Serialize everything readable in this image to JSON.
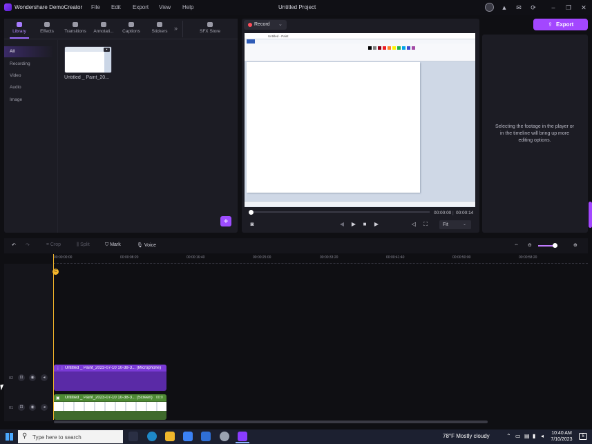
{
  "app": {
    "name": "Wondershare DemoCreator",
    "project_title": "Untitled Project"
  },
  "menu": {
    "file": "File",
    "edit": "Edit",
    "export": "Export",
    "view": "View",
    "help": "Help"
  },
  "tabs": [
    {
      "label": "Library",
      "icon": "layers-icon"
    },
    {
      "label": "Effects",
      "icon": "sparkle-icon"
    },
    {
      "label": "Transitions",
      "icon": "transition-icon"
    },
    {
      "label": "Annotati...",
      "icon": "annotation-icon"
    },
    {
      "label": "Captions",
      "icon": "caption-icon"
    },
    {
      "label": "Stickers",
      "icon": "sticker-icon"
    },
    {
      "label": "SFX Store",
      "icon": "store-icon"
    }
  ],
  "categories": [
    "All",
    "Recording",
    "Video",
    "Audio",
    "Image"
  ],
  "library": {
    "item_label": "Untitled _ Paint_20..."
  },
  "preview": {
    "record_label": "Record",
    "paint_title": "Untitled - Paint",
    "time_current": "00:00:00",
    "time_separator": "|",
    "time_total": "00:00:14",
    "fit_label": "Fit"
  },
  "export_label": "Export",
  "properties_hint": "Selecting the footage in the player or in the timeline will bring up more editing options.",
  "timeline": {
    "tools": {
      "crop": "Crop",
      "split": "Split",
      "mark": "Mark",
      "voice": "Voice"
    },
    "ticks": [
      "00:00:00:00",
      "00:00:08:20",
      "00:00:16:40",
      "00:00:25:00",
      "00:00:33:20",
      "00:00:41:40",
      "00:00:50:00",
      "00:00:58:20"
    ],
    "zoom_level": 0.85,
    "tracks": [
      {
        "num": "02",
        "clip_label": "Untitled _ Paint_2023-07-10 10-38-3... (Microphone)"
      },
      {
        "num": "01",
        "clip_label": "Untitled _ Paint_2023-07-10 10-38-3... (Screen)",
        "clip_time": "00:0"
      }
    ]
  },
  "taskbar": {
    "search_placeholder": "Type here to search",
    "weather": "78°F  Mostly cloudy",
    "time": "10:40 AM",
    "date": "7/10/2023",
    "notification_count": "5"
  },
  "colors": {
    "accent": "#a347ff",
    "playhead": "#f4b62b",
    "audio_clip": "#5a2aa6",
    "video_clip": "#3f6a2c"
  }
}
